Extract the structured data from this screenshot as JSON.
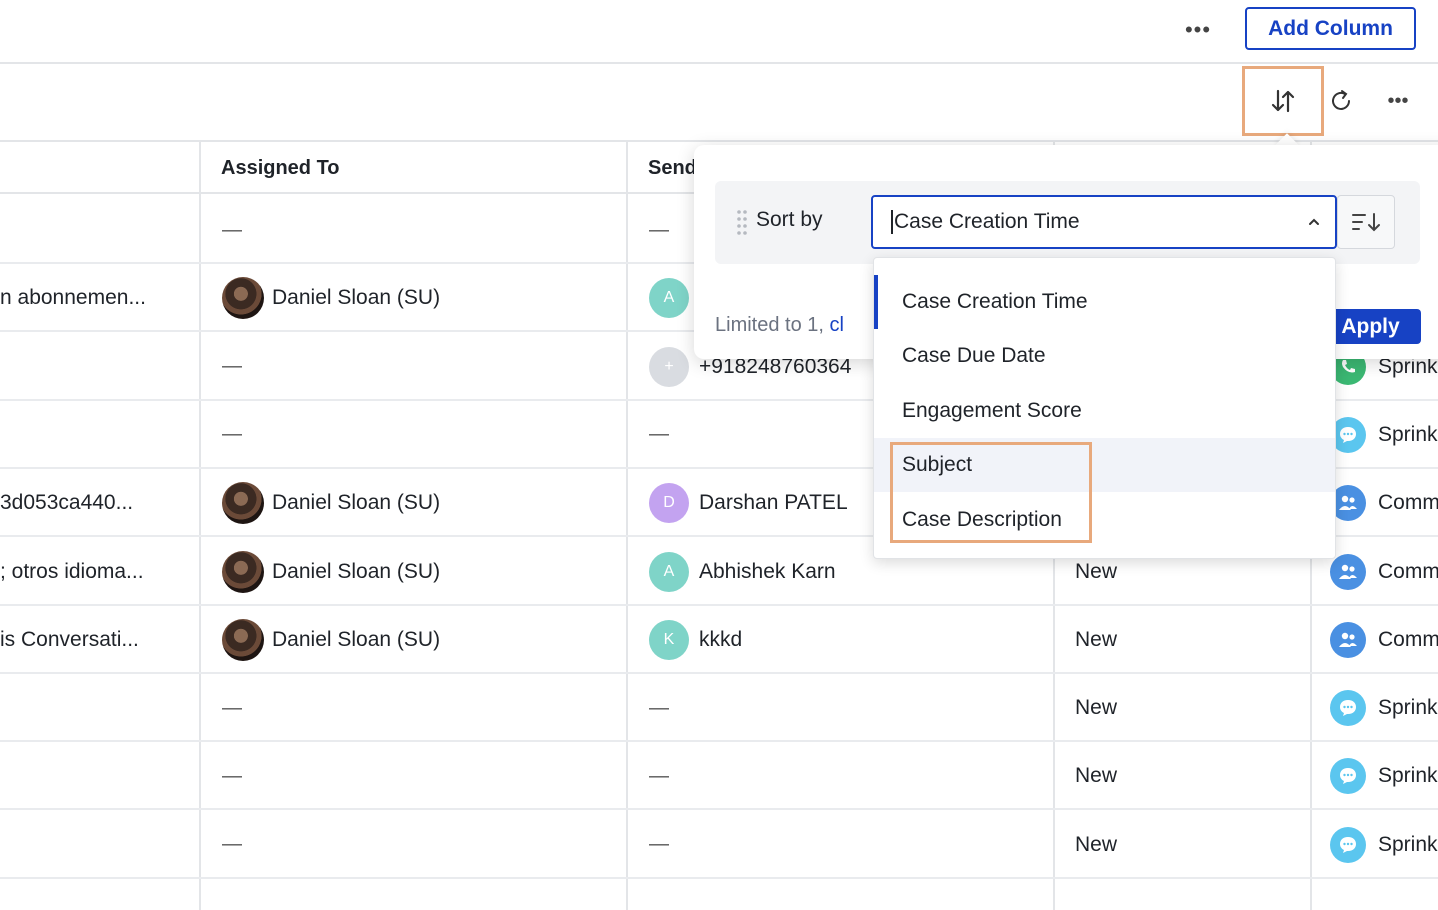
{
  "topbar": {
    "more_label": "•••",
    "add_column_label": "Add Column"
  },
  "toolbar": {
    "more_label": "•••"
  },
  "table": {
    "headers": {
      "assigned_to": "Assigned To",
      "sender": "Send"
    },
    "rows": [
      {
        "subject": "",
        "assigned": "—",
        "sender": "—",
        "status": "",
        "channel": ""
      },
      {
        "subject": "n abonnemen...",
        "assigned": "Daniel Sloan (SU)",
        "sender_initial": "A",
        "sender": "",
        "status": "",
        "channel": ""
      },
      {
        "subject": "",
        "assigned": "—",
        "sender_initial": "+",
        "sender": "+918248760364",
        "status": "",
        "channel": "Sprinkl"
      },
      {
        "subject": "",
        "assigned": "—",
        "sender": "—",
        "status": "",
        "channel": "Sprinkl"
      },
      {
        "subject": "3d053ca440...",
        "assigned": "Daniel Sloan (SU)",
        "sender_initial": "D",
        "sender": "Darshan PATEL",
        "status": "",
        "channel": "Comm"
      },
      {
        "subject": "; otros idioma...",
        "assigned": "Daniel Sloan (SU)",
        "sender_initial": "A",
        "sender": "Abhishek Karn",
        "status": "New",
        "channel": "Comm"
      },
      {
        "subject": "is Conversati...",
        "assigned": "Daniel Sloan (SU)",
        "sender_initial": "K",
        "sender": "kkkd",
        "status": "New",
        "channel": "Comm"
      },
      {
        "subject": "",
        "assigned": "—",
        "sender": "—",
        "status": "New",
        "channel": "Sprinkl"
      },
      {
        "subject": "",
        "assigned": "—",
        "sender": "—",
        "status": "New",
        "channel": "Sprinkl"
      },
      {
        "subject": "",
        "assigned": "—",
        "sender": "—",
        "status": "New",
        "channel": "Sprinkl"
      }
    ]
  },
  "sort_popover": {
    "sort_by_label": "Sort by",
    "selected_value": "Case Creation Time",
    "limit_text": "Limited to 1, ",
    "limit_link": "cl",
    "apply_label": "Apply",
    "options": [
      "Case Creation Time",
      "Case Due Date",
      "Engagement Score",
      "Subject",
      "Case Description"
    ]
  },
  "colors": {
    "accent": "#1742c4",
    "highlight": "#e8a97c",
    "avatar_A": "#7fd4c8",
    "avatar_plus": "#d9dce1",
    "avatar_D": "#c3a3f0",
    "avatar_K": "#7fd4c8",
    "icon_chat": "#5bc6ef",
    "icon_community": "#4a90e2",
    "icon_phone": "#3bb873"
  },
  "icons": {
    "sort": "sort-arrows-icon",
    "refresh": "refresh-icon",
    "order": "sort-descending-icon",
    "grip": "drag-handle-icon",
    "chevron": "chevron-up-icon"
  }
}
